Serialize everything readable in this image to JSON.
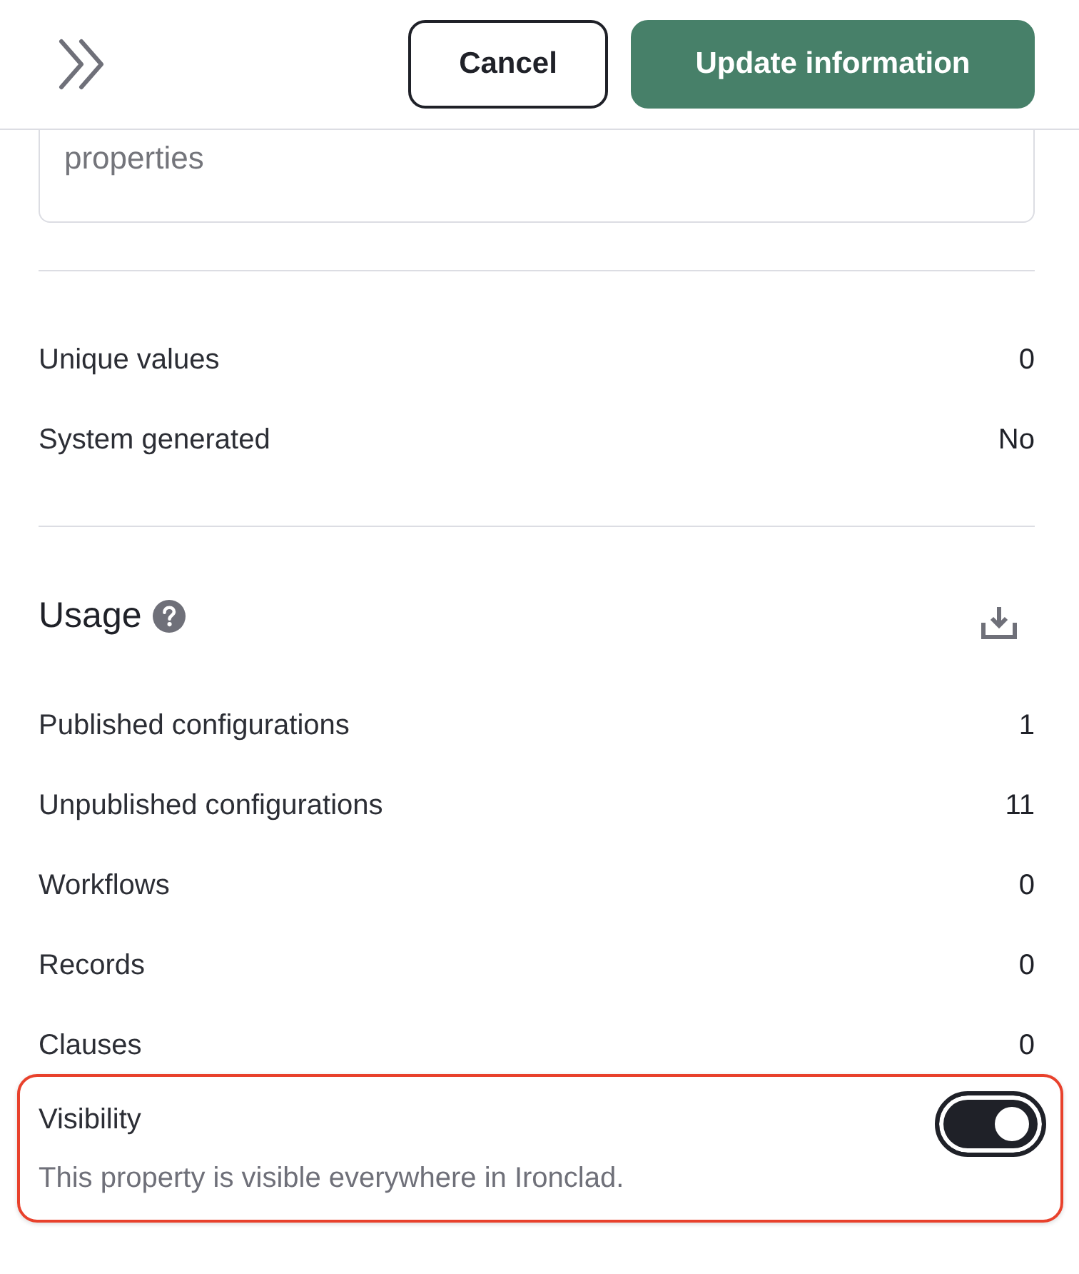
{
  "header": {
    "buttons": [
      {
        "label": "Cancel",
        "kind": "secondary"
      },
      {
        "label": "Update information",
        "kind": "primary"
      }
    ]
  },
  "description_field": {
    "placeholder": "properties"
  },
  "stats": [
    {
      "label": "Unique values",
      "value": "0"
    },
    {
      "label": "System generated",
      "value": "No"
    }
  ],
  "usage": {
    "title": "Usage",
    "rows": [
      {
        "label": "Published configurations",
        "value": "1"
      },
      {
        "label": "Unpublished configurations",
        "value": "11"
      },
      {
        "label": "Workflows",
        "value": "0"
      },
      {
        "label": "Records",
        "value": "0"
      },
      {
        "label": "Clauses",
        "value": "0"
      }
    ]
  },
  "visibility": {
    "title": "Visibility",
    "description": "This property is visible everywhere in Ironclad.",
    "on": true,
    "highlighted": true
  }
}
